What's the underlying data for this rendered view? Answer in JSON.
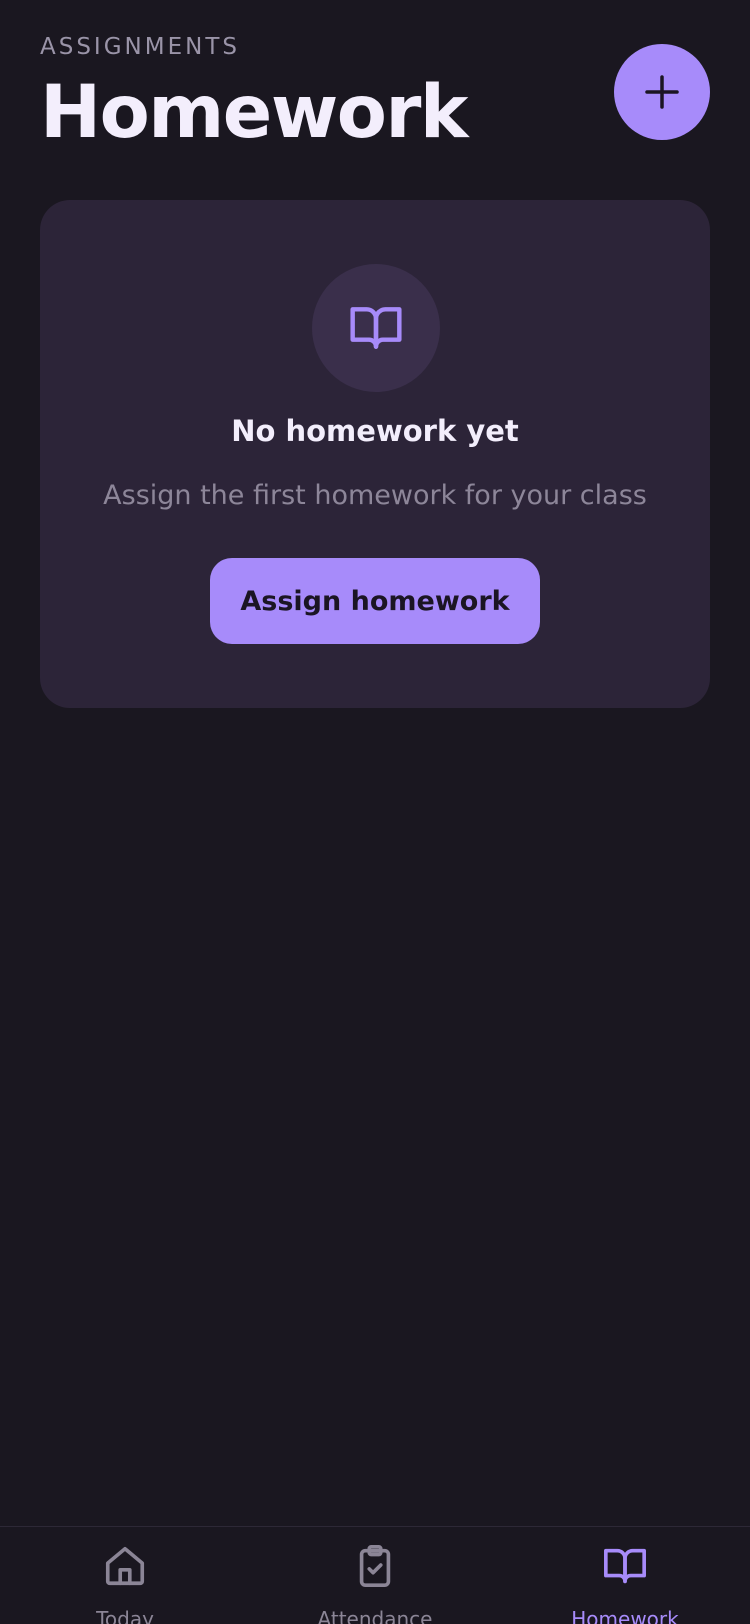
{
  "header": {
    "eyebrow": "ASSIGNMENTS",
    "title": "Homework",
    "add_action_icon": "plus-icon"
  },
  "empty_state": {
    "icon": "book-open-icon",
    "title": "No homework yet",
    "description": "Assign the first homework for your class",
    "button_label": "Assign homework"
  },
  "tab_bar": {
    "items": [
      {
        "label": "Today",
        "icon": "home-icon",
        "active": false
      },
      {
        "label": "Attendance",
        "icon": "clipboard-check-icon",
        "active": false
      },
      {
        "label": "Homework",
        "icon": "book-open-icon",
        "active": true
      }
    ]
  },
  "colors": {
    "background": "#1a1720",
    "card": "#2c2438",
    "accent": "#a78bfa",
    "muted_text": "#8d8699"
  }
}
